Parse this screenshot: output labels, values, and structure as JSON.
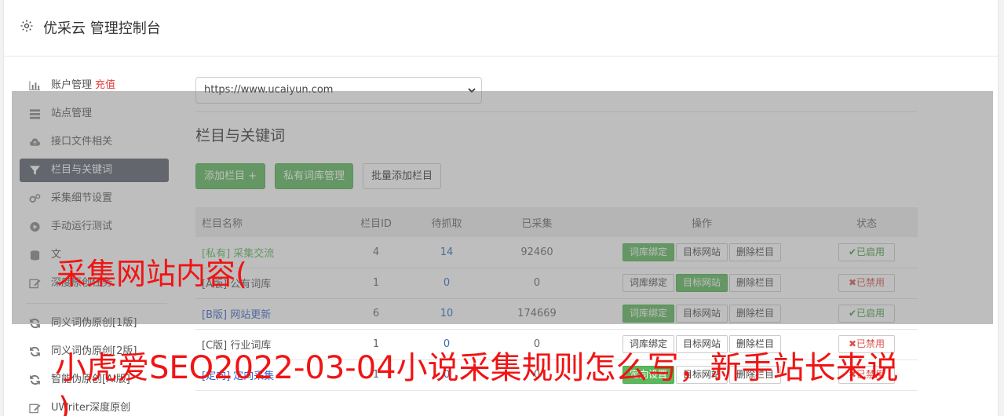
{
  "header": {
    "title": "优采云 管理控制台",
    "icon": "gear-icon"
  },
  "sidebar": {
    "items": [
      {
        "label": "账户管理",
        "extra": "充值",
        "icon": "bar-chart-icon"
      },
      {
        "label": "站点管理",
        "icon": "server-icon"
      },
      {
        "label": "接口文件相关",
        "icon": "cloud-upload-icon"
      },
      {
        "label": "栏目与关键词",
        "icon": "filter-icon",
        "active": true
      },
      {
        "label": "采集细节设置",
        "icon": "cogs-icon"
      },
      {
        "label": "手动运行测试",
        "icon": "play-circle-icon"
      },
      {
        "label": "文",
        "icon": "database-icon"
      },
      {
        "label": "深度原创任务",
        "icon": "edit-icon"
      }
    ],
    "items2": [
      {
        "label": "同义词伪原创[1版]",
        "icon": "refresh-icon"
      },
      {
        "label": "同义词伪原创[2版]",
        "icon": "refresh-icon"
      },
      {
        "label": "智能伪原创[AI版]",
        "icon": "refresh-icon"
      },
      {
        "label": "UWriter深度原创",
        "icon": "edit-icon"
      }
    ]
  },
  "main": {
    "site_select": "https://www.ucaiyun.com",
    "section_title": "栏目与关键词",
    "buttons": {
      "add": "添加栏目 +",
      "private_lib": "私有词库管理",
      "batch_add": "批量添加栏目"
    },
    "table": {
      "headers": [
        "栏目名称",
        "栏目ID",
        "待抓取",
        "已采集",
        "操作",
        "状态"
      ],
      "rows": [
        {
          "tag": "[私有]",
          "name": "采集交流",
          "id": "4",
          "pending": "14",
          "collected": "92460",
          "b1": "词库绑定",
          "b2": "目标网站",
          "b3": "删除栏目",
          "active": "b1",
          "status": "✔已启用",
          "ok": true
        },
        {
          "tag": "[A版]",
          "name": "公有词库",
          "id": "1",
          "pending": "0",
          "collected": "0",
          "b1": "词库绑定",
          "b2": "目标网站",
          "b3": "删除栏目",
          "active": "b2",
          "status": "✖已禁用",
          "ok": false
        },
        {
          "tag": "[B版]",
          "name": "网站更新",
          "id": "6",
          "pending": "10",
          "collected": "174669",
          "b1": "词库绑定",
          "b2": "目标网站",
          "b3": "删除栏目",
          "active": "b1",
          "status": "✔已启用",
          "ok": true
        },
        {
          "tag": "[C版]",
          "name": "行业词库",
          "id": "1",
          "pending": "0",
          "collected": "0",
          "b1": "词库绑定",
          "b2": "目标网站",
          "b3": "删除栏目",
          "active": "",
          "status": "✖已禁用",
          "ok": false
        },
        {
          "tag": "[定向]",
          "name": "定向采集",
          "id": "1",
          "pending": "0",
          "collected": "0",
          "b1": "定向设置",
          "b2": "目标网站",
          "b3": "删除栏目",
          "active": "b1",
          "status": "✖已禁用",
          "ok": false
        }
      ]
    }
  },
  "watermark": {
    "line1": "采集网站内容(",
    "line2": "小虎爱SEO2022-03-04小说采集规则怎么写，新手站长来说",
    "line3": ")"
  },
  "colors": {
    "accent_green": "#5cb85c",
    "active_nav": "#5a5f6b",
    "watermark_red": "#f01414"
  }
}
